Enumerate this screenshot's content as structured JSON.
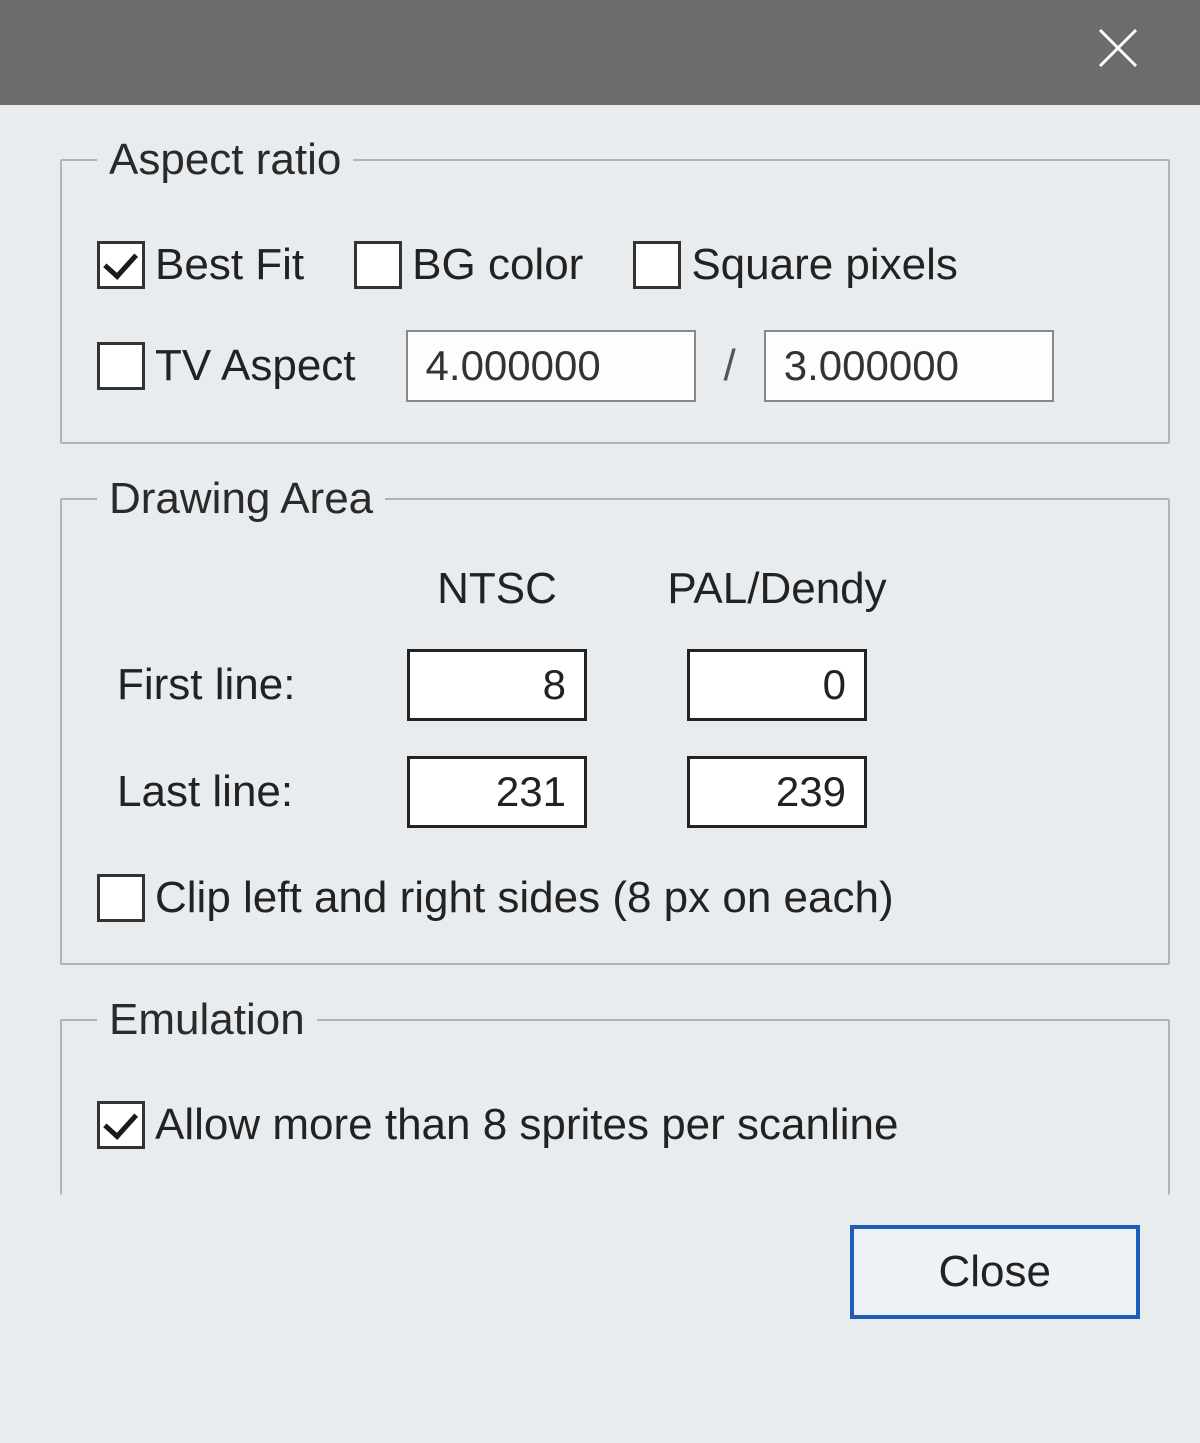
{
  "aspect_ratio": {
    "legend": "Aspect ratio",
    "best_fit": {
      "label": "Best Fit",
      "checked": true
    },
    "bg_color": {
      "label": "BG color",
      "checked": false
    },
    "square_pixels": {
      "label": "Square pixels",
      "checked": false
    },
    "tv_aspect": {
      "label": "TV Aspect",
      "checked": false
    },
    "ratio_num": "4.000000",
    "ratio_sep": "/",
    "ratio_den": "3.000000"
  },
  "drawing_area": {
    "legend": "Drawing Area",
    "col_ntsc": "NTSC",
    "col_pal": "PAL/Dendy",
    "first_line_label": "First line:",
    "last_line_label": "Last line:",
    "first_line_ntsc": "8",
    "first_line_pal": "0",
    "last_line_ntsc": "231",
    "last_line_pal": "239",
    "clip": {
      "label": "Clip left and right sides (8 px on each)",
      "checked": false
    }
  },
  "emulation": {
    "legend": "Emulation",
    "allow_sprites": {
      "label": "Allow more than 8 sprites per scanline",
      "checked": true
    }
  },
  "close_button": "Close"
}
